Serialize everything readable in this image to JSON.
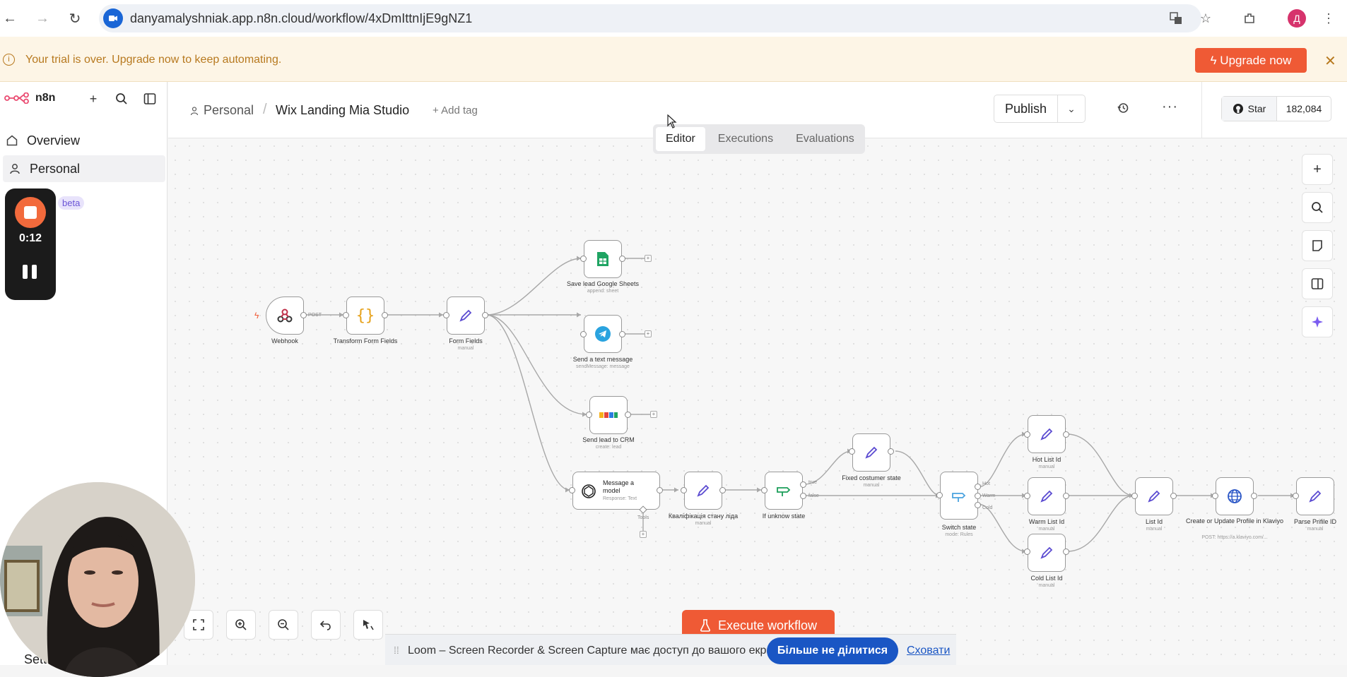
{
  "browser": {
    "url": "danyamalyshniak.app.n8n.cloud/workflow/4xDmIttnIjE9gNZ1",
    "avatar_letter": "Д"
  },
  "banner": {
    "text": "Your trial is over. Upgrade now to keep automating.",
    "upgrade_label": "Upgrade now"
  },
  "sidebar": {
    "logo_text": "n8n",
    "items": [
      {
        "label": "Overview",
        "icon": "home-icon"
      },
      {
        "label": "Personal",
        "icon": "user-icon"
      }
    ],
    "beta_badge": "beta",
    "settings_label": "Sett"
  },
  "recorder": {
    "time": "0:12"
  },
  "header": {
    "crumb_personal": "Personal",
    "workflow_name": "Wix Landing Mia Studio",
    "add_tag": "+ Add tag",
    "publish_label": "Publish",
    "github_star": "Star",
    "github_count": "182,084"
  },
  "tabs": [
    {
      "label": "Editor",
      "active": true
    },
    {
      "label": "Executions",
      "active": false
    },
    {
      "label": "Evaluations",
      "active": false
    }
  ],
  "nodes": {
    "webhook": {
      "label": "Webhook",
      "out_label": "POST"
    },
    "transform": {
      "label": "Transform Form Fields"
    },
    "form_fields": {
      "label": "Form Fields",
      "sub": "manual"
    },
    "sheets": {
      "label": "Save lead Google Sheets",
      "sub": "append: sheet"
    },
    "telegram": {
      "label": "Send a text message",
      "sub": "sendMessage: message"
    },
    "crm": {
      "label": "Send lead to CRM",
      "sub": "create: lead"
    },
    "openai": {
      "label": "Message a model",
      "sub": "Response: Text",
      "tools_label": "Tools"
    },
    "qualify": {
      "label": "Кваліфікація стану ліда",
      "sub": "manual"
    },
    "if_unknow": {
      "label": "If unknow state",
      "true_label": "true",
      "false_label": "false"
    },
    "fixed_state": {
      "label": "Fixed costumer state",
      "sub": "manual"
    },
    "switch": {
      "label": "Switch state",
      "sub": "mode: Rules",
      "out_hot": "Hot",
      "out_warm": "Warm",
      "out_cold": "Cold"
    },
    "hot": {
      "label": "Hot List Id",
      "sub": "manual"
    },
    "warm": {
      "label": "Warm List Id",
      "sub": "manual"
    },
    "cold": {
      "label": "Cold List Id",
      "sub": "manual"
    },
    "list_id": {
      "label": "List Id",
      "sub": "manual"
    },
    "klaviyo": {
      "label": "Create or Update Profile in Klaviyo",
      "sub": "POST: https://a.klaviyo.com/..."
    },
    "parse": {
      "label": "Parse Prifile ID",
      "sub": "manual"
    }
  },
  "execute_label": "Execute workflow",
  "loom": {
    "text": "Loom – Screen Recorder & Screen Capture має доступ до вашого екрана.",
    "stop_label": "Більше не ділитися",
    "hide_label": "Сховати"
  },
  "colors": {
    "accent": "#ef5a35",
    "banner_bg": "#fdf5e6",
    "loom_blue": "#1a56c4"
  }
}
